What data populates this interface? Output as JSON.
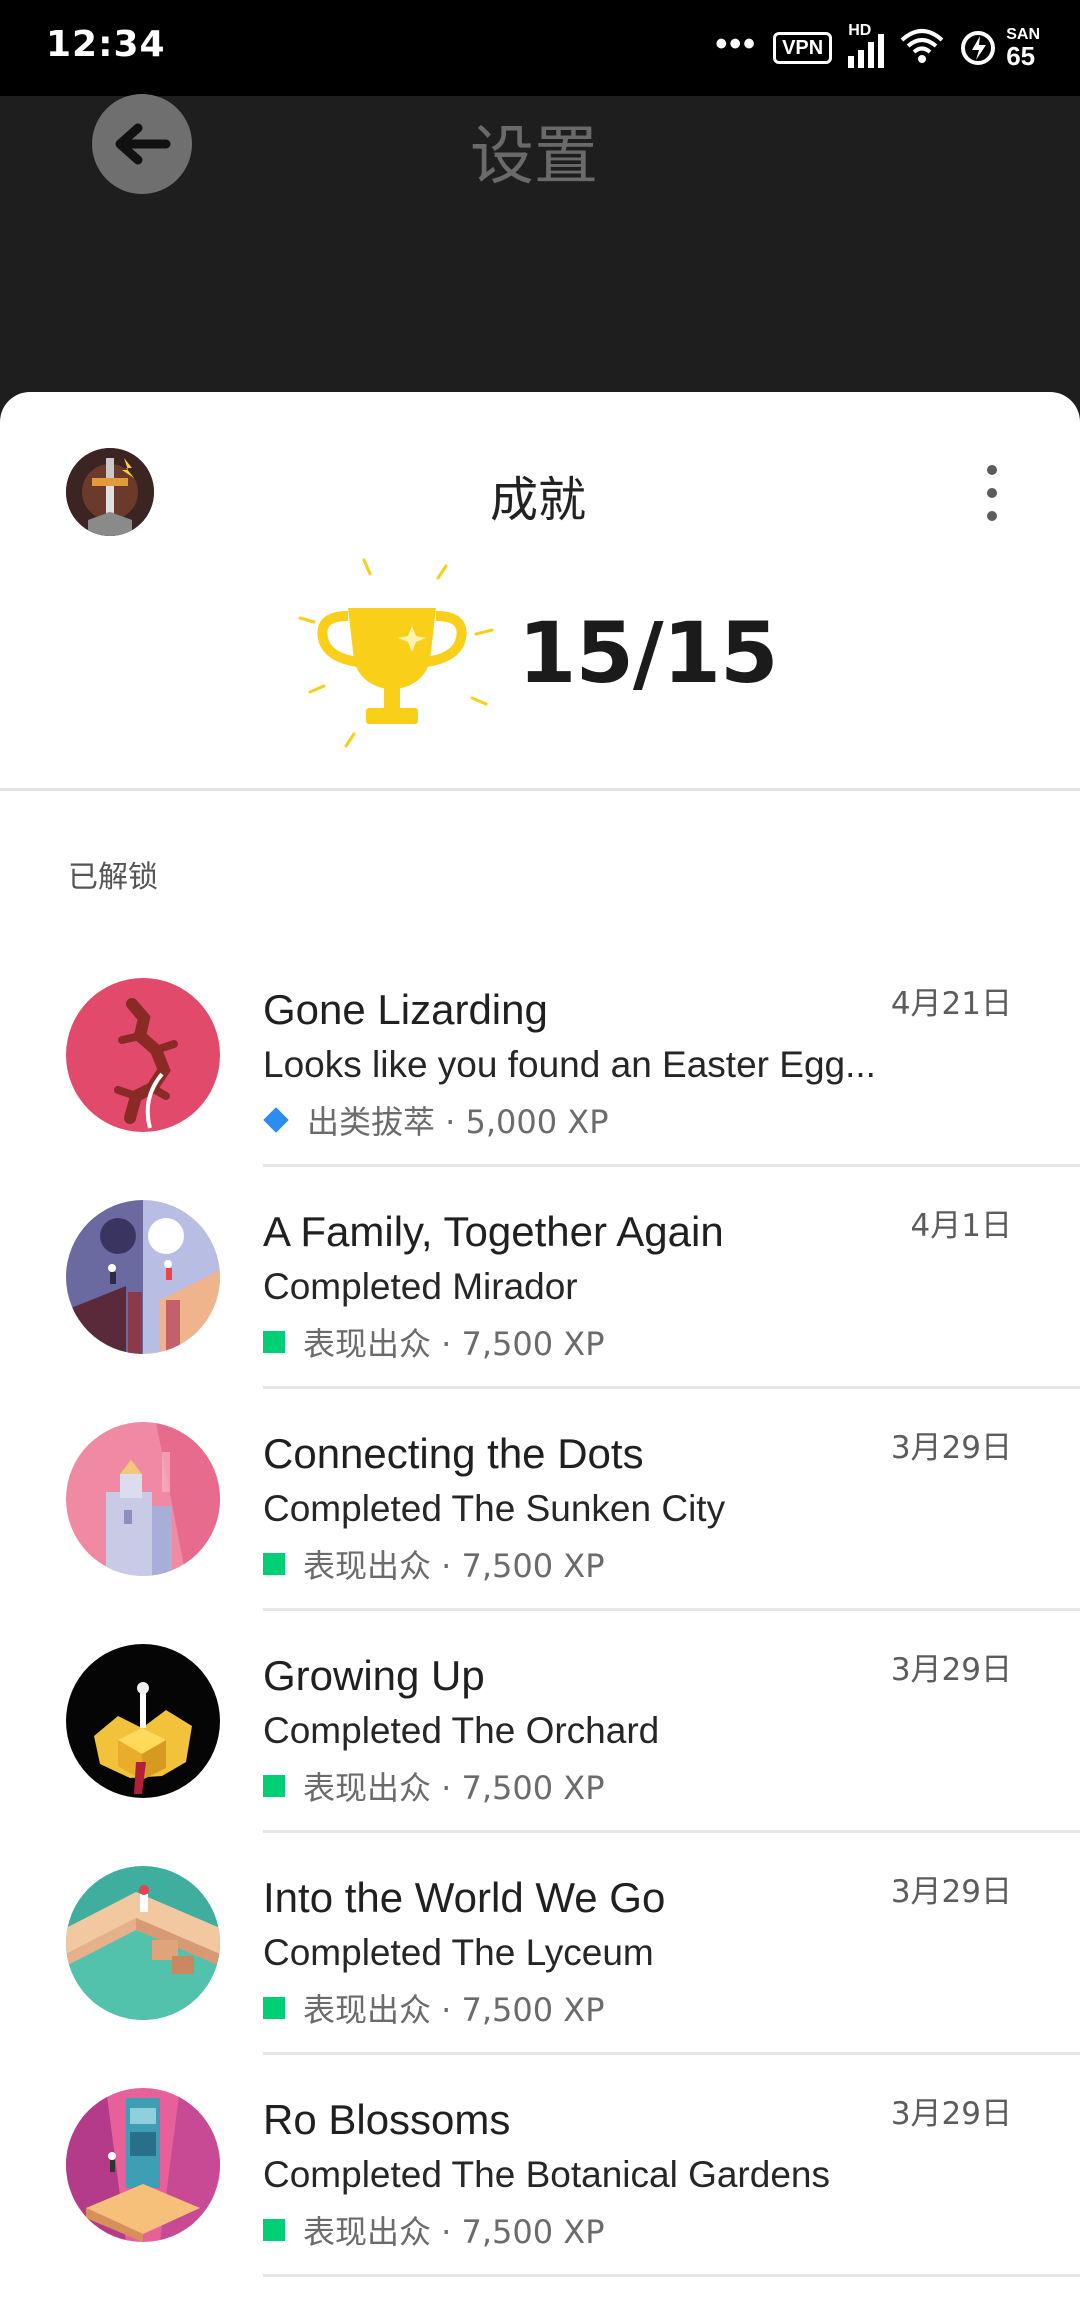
{
  "status_bar": {
    "time": "12:34",
    "dots": "•••",
    "vpn": "VPN",
    "hd": "HD",
    "battery_small": "SAN",
    "battery_value": "65"
  },
  "background_page": {
    "title": "设置",
    "back_icon": "arrow-left-icon"
  },
  "sheet": {
    "title": "成就",
    "score": "15/15",
    "section_label": "已解锁",
    "more_icon": "more-vert-icon",
    "colors": {
      "trophy": "#f9cf1a",
      "common_rarity": "#00d075",
      "rare_rarity": "#2d8cf0"
    }
  },
  "achievements": [
    {
      "title": "Gone Lizarding",
      "description": "Looks like you found an Easter Egg...",
      "meta": "出类拔萃 · 5,000 XP",
      "date": "4月21日",
      "rarity": "blue"
    },
    {
      "title": "A Family, Together Again",
      "description": "Completed Mirador",
      "meta": "表现出众 · 7,500 XP",
      "date": "4月1日",
      "rarity": "green"
    },
    {
      "title": "Connecting the Dots",
      "description": "Completed The Sunken City",
      "meta": "表现出众 · 7,500 XP",
      "date": "3月29日",
      "rarity": "green"
    },
    {
      "title": "Growing Up",
      "description": "Completed The Orchard",
      "meta": "表现出众 · 7,500 XP",
      "date": "3月29日",
      "rarity": "green"
    },
    {
      "title": "Into the World We Go",
      "description": "Completed The Lyceum",
      "meta": "表现出众 · 7,500 XP",
      "date": "3月29日",
      "rarity": "green"
    },
    {
      "title": "Ro Blossoms",
      "description": "Completed The Botanical Gardens",
      "meta": "表现出众 · 7,500 XP",
      "date": "3月29日",
      "rarity": "green"
    }
  ]
}
